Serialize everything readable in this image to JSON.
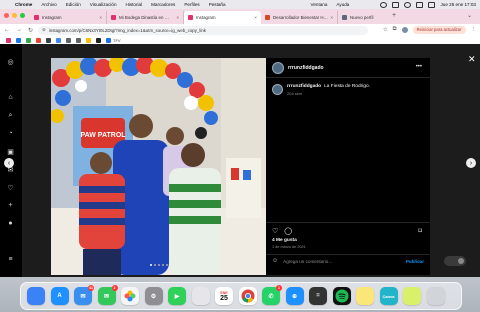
{
  "menubar": {
    "app": "Chrome",
    "items": [
      "Archivo",
      "Edición",
      "Visualización",
      "Historial",
      "Marcadores",
      "Perfiles",
      "Pestaña",
      "Ventana",
      "Ayuda"
    ],
    "clock": "Jue 25 ene  17:03"
  },
  "tabs": [
    {
      "title": "Instagram",
      "color": "#e1306c"
    },
    {
      "title": "Mi Bodega Dinastía en …",
      "color": "#e1306c"
    },
    {
      "title": "Instagram",
      "color": "#e1306c",
      "active": true
    },
    {
      "title": "Desarrollador Bienestar H…",
      "color": "#d04a2a"
    },
    {
      "title": "Nuevo perfil",
      "color": "#5a6a7a"
    }
  ],
  "toolbar": {
    "url": "instagram.com/p/C6Nx3Yt0L2Dtg/?img_index=1&utm_source=ig_web_copy_link",
    "restart": "Reiniciar para actualizar"
  },
  "bookmarks": [
    {
      "label": "",
      "color": "#e1306c"
    },
    {
      "label": "",
      "color": "#1877f2"
    },
    {
      "label": "",
      "color": "#34a853"
    },
    {
      "label": "",
      "color": "#ea4335"
    },
    {
      "label": "",
      "color": "#3c4043"
    },
    {
      "label": "",
      "color": "#4285f4"
    },
    {
      "label": "",
      "color": "#5f6368"
    },
    {
      "label": "",
      "color": "#5f6368"
    },
    {
      "label": "",
      "color": "#fbbc04"
    },
    {
      "label": "",
      "color": "#202124"
    },
    {
      "label": "TFV",
      "color": "#1a73e8"
    }
  ],
  "post": {
    "username": "rrrunzfiddgado",
    "caption_user": "rrrunzfiddgado",
    "caption_text": "La Fiesta de Rodrigo.",
    "caption_time": "204 sem",
    "likes": "4 Me gusta",
    "date": "1 de marzo de 2021",
    "comment_placeholder": "Agrega un comentario...",
    "publish": "Publicar",
    "photo_sign": "PAW PATROL"
  },
  "dock": [
    {
      "name": "finder",
      "color": "#3b82f6",
      "glyph": ""
    },
    {
      "name": "app-store",
      "color": "#1e90ff",
      "glyph": "A"
    },
    {
      "name": "mail",
      "color": "#3a8ef0",
      "glyph": "✉",
      "badge": "41"
    },
    {
      "name": "messages",
      "color": "#34c759",
      "glyph": "✉",
      "badge": "2"
    },
    {
      "name": "photos",
      "color": "#f5f5f5",
      "glyph": ""
    },
    {
      "name": "system-settings",
      "color": "#8e8e93",
      "glyph": "⚙"
    },
    {
      "name": "facetime",
      "color": "#30d158",
      "glyph": "▶"
    },
    {
      "name": "launchpad",
      "color": "#e5e5ea",
      "glyph": ""
    },
    {
      "name": "calendar",
      "color": "#ffffff",
      "glyph": "25",
      "month": "ENE"
    },
    {
      "name": "chrome",
      "color": "#ffffff",
      "glyph": ""
    },
    {
      "name": "whatsapp",
      "color": "#25d366",
      "glyph": "✆",
      "badge": "1"
    },
    {
      "name": "safari",
      "color": "#1e90ff",
      "glyph": "⊕"
    },
    {
      "name": "calculator",
      "color": "#333333",
      "glyph": "="
    },
    {
      "name": "spotify",
      "color": "#111111",
      "glyph": ""
    },
    {
      "name": "notes",
      "color": "#fbe67a",
      "glyph": ""
    },
    {
      "name": "canva",
      "color": "#22b5c9",
      "glyph": "Canva"
    },
    {
      "name": "quick-note",
      "color": "#d9f16a",
      "glyph": ""
    },
    {
      "name": "trash",
      "color": "#d1d4d9",
      "glyph": ""
    }
  ]
}
